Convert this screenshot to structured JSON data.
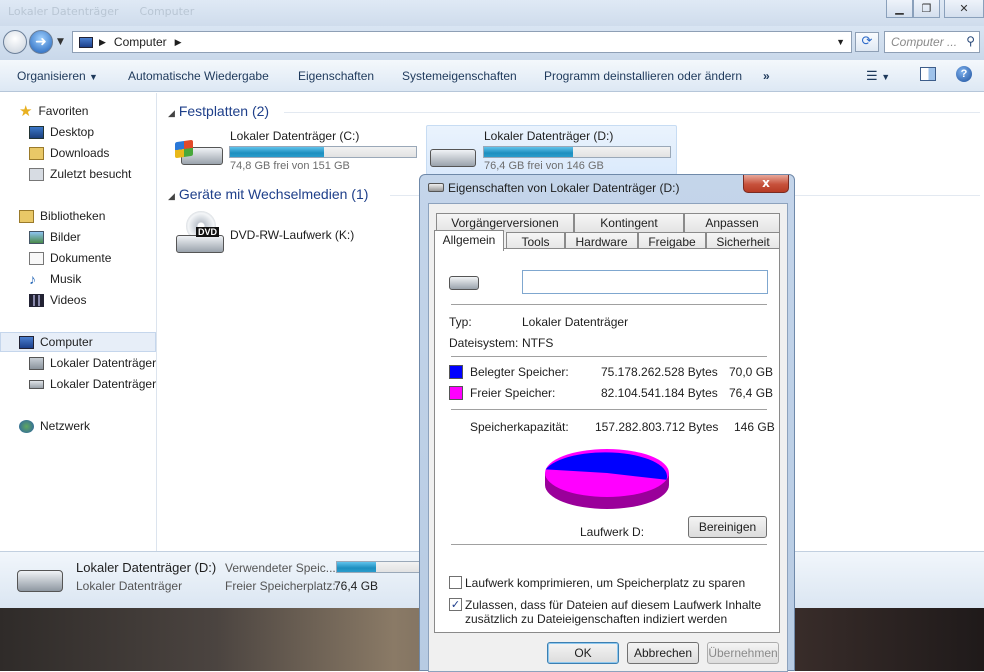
{
  "window": {
    "ghost_title_1": "Lokaler Datenträger",
    "ghost_title_2": "Computer"
  },
  "address": {
    "path": "Computer",
    "search_placeholder": "Computer ..."
  },
  "toolbar": {
    "items": [
      "Organisieren",
      "Automatische Wiedergabe",
      "Eigenschaften",
      "Systemeigenschaften",
      "Programm deinstallieren oder ändern"
    ],
    "more": "»"
  },
  "sidebar": {
    "favorites": "Favoriten",
    "fav_items": [
      "Desktop",
      "Downloads",
      "Zuletzt besucht"
    ],
    "libraries": "Bibliotheken",
    "lib_items": [
      "Bilder",
      "Dokumente",
      "Musik",
      "Videos"
    ],
    "computer": "Computer",
    "comp_items": [
      "Lokaler Datenträger",
      "Lokaler Datenträger"
    ],
    "network": "Netzwerk"
  },
  "content": {
    "group1": "Festplatten (2)",
    "group2": "Geräte mit Wechselmedien (1)",
    "drives": [
      {
        "name": "Lokaler Datenträger (C:)",
        "free": "74,8 GB frei von 151 GB",
        "used_fraction": 0.505
      },
      {
        "name": "Lokaler Datenträger (D:)",
        "free": "76,4 GB frei von 146 GB",
        "used_fraction": 0.478
      }
    ],
    "dvd": {
      "name": "DVD-RW-Laufwerk (K:)",
      "badge": "DVD"
    }
  },
  "status": {
    "name": "Lokaler Datenträger (D:)",
    "type": "Lokaler Datenträger",
    "used_label": "Verwendeter Speic...",
    "free_label": "Freier Speicherplatz:",
    "free_value": "76,4 GB",
    "used_fraction": 0.478
  },
  "dialog": {
    "title": "Eigenschaften von Lokaler Datenträger (D:)",
    "close": "x",
    "tabs_row1": [
      "Vorgängerversionen",
      "Kontingent",
      "Anpassen"
    ],
    "tabs_row2": [
      "Allgemein",
      "Tools",
      "Hardware",
      "Freigabe",
      "Sicherheit"
    ],
    "label_value": "",
    "type_label": "Typ:",
    "type_value": "Lokaler Datenträger",
    "fs_label": "Dateisystem:",
    "fs_value": "NTFS",
    "used_label": "Belegter Speicher:",
    "used_bytes": "75.178.262.528 Bytes",
    "used_gb": "70,0 GB",
    "free_label": "Freier Speicher:",
    "free_bytes": "82.104.541.184 Bytes",
    "free_gb": "76,4 GB",
    "cap_label": "Speicherkapazität:",
    "cap_bytes": "157.282.803.712 Bytes",
    "cap_gb": "146 GB",
    "drive_label": "Laufwerk D:",
    "cleanup_button": "Bereinigen",
    "compress_label": "Laufwerk komprimieren, um Speicherplatz zu sparen",
    "compress_checked": false,
    "index_label_1": "Zulassen, dass für Dateien auf diesem Laufwerk Inhalte",
    "index_label_2": "zusätzlich zu Dateieigenschaften indiziert werden",
    "index_checked": true,
    "ok": "OK",
    "cancel": "Abbrechen",
    "apply": "Übernehmen",
    "colors": {
      "used": "#0000ff",
      "free": "#ff00ff"
    },
    "pie_used_fraction": 0.478
  }
}
